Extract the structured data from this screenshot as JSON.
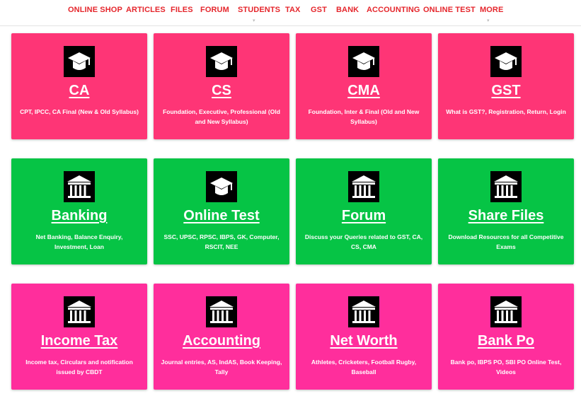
{
  "nav": {
    "items": [
      "ONLINE SHOP",
      "ARTICLES",
      "FILES",
      "FORUM",
      "STUDENTS",
      "TAX",
      "GST",
      "BANK",
      "ACCOUNTING",
      "ONLINE TEST",
      "MORE"
    ]
  },
  "colors": {
    "nav_text": "#e5262c",
    "card_pink": "#fe3576",
    "card_green": "#06c445",
    "card_magenta": "#ff2e9c"
  },
  "cards": [
    {
      "title": "CA",
      "description": "CPT, IPCC, CA Final (New & Old Syllabus)",
      "icon": "graduation-cap-icon"
    },
    {
      "title": "CS",
      "description": "Foundation, Executive, Professional (Old and New Syllabus)",
      "icon": "graduation-cap-icon"
    },
    {
      "title": "CMA",
      "description": "Foundation, Inter & Final (Old and New Syllabus)",
      "icon": "graduation-cap-icon"
    },
    {
      "title": "GST",
      "description": "What is GST?, Registration, Return, Login",
      "icon": "graduation-cap-icon"
    },
    {
      "title": "Banking",
      "description": "Net Banking, Balance Enquiry, Investment, Loan",
      "icon": "bank-icon"
    },
    {
      "title": "Online Test",
      "description": "SSC, UPSC, RPSC, IBPS, GK, Computer, RSCIT, NEE",
      "icon": "graduation-cap-icon"
    },
    {
      "title": "Forum",
      "description": "Discuss your Queries related to GST, CA, CS, CMA",
      "icon": "bank-icon"
    },
    {
      "title": "Share Files",
      "description": "Download Resources for all Competitive Exams",
      "icon": "bank-icon"
    },
    {
      "title": "Income Tax",
      "description": "Income tax, Circulars and notification issued by CBDT",
      "icon": "bank-icon"
    },
    {
      "title": "Accounting",
      "description": "Journal entries, AS, IndAS, Book Keeping, Tally",
      "icon": "bank-icon"
    },
    {
      "title": "Net Worth",
      "description": "Athletes, Cricketers, Football Rugby, Baseball",
      "icon": "bank-icon"
    },
    {
      "title": "Bank Po",
      "description": "Bank po, IBPS PO, SBI PO Online Test, Videos",
      "icon": "bank-icon"
    }
  ]
}
